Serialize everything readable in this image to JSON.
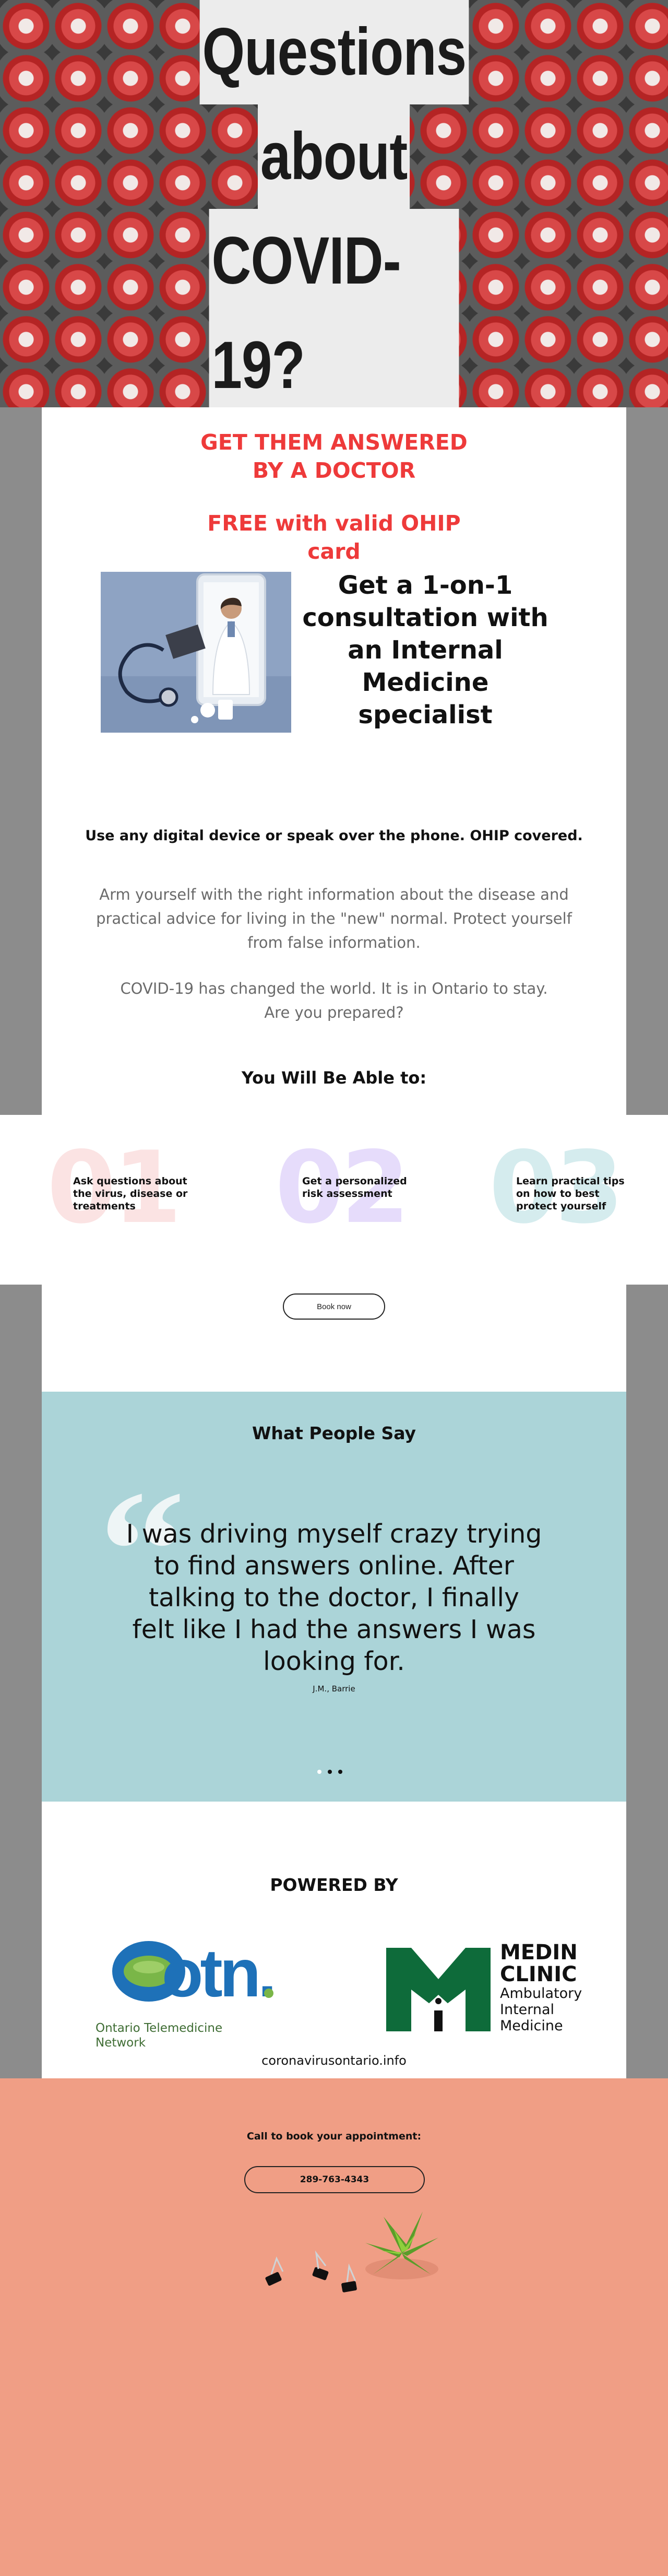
{
  "hero": {
    "title_lines": [
      "Questions",
      "about",
      "COVID-19?"
    ]
  },
  "intro": {
    "headline": "GET THEM ANSWERED BY A DOCTOR",
    "free_line": "FREE with valid OHIP card",
    "consult_title": "Get a 1-on-1 consultation with an Internal Medicine specialist",
    "digital_line": "Use any digital device or speak over the phone. OHIP covered.",
    "arm_paragraph": "Arm yourself with the right information about the disease and practical advice for living in the \"new\" normal. Protect yourself from false information.",
    "covid_line1": "COVID-19 has changed the world. It is in Ontario to stay.",
    "covid_line2": "Are you prepared?",
    "able_heading": "You Will Be Able to:"
  },
  "features": [
    {
      "number": "01",
      "text": "Ask questions about the virus, disease or treatments",
      "color": "#fbe3e3"
    },
    {
      "number": "02",
      "text": "Get a personalized risk assessment",
      "color": "#e6dcfb"
    },
    {
      "number": "03",
      "text": "Learn practical tips on how to best protect yourself",
      "color": "#d5ecee"
    }
  ],
  "book_now": {
    "label": "Book now"
  },
  "testimonial": {
    "heading": "What People Say",
    "quote": "I was driving myself crazy trying to find answers online. After talking to the doctor, I finally felt like I had the answers I was looking for.",
    "author": "J.M., Barrie",
    "slide_count": 3,
    "active_slide": 1
  },
  "partners": {
    "heading": "POWERED BY",
    "otn_logo_text": "otn.",
    "otn_name": "Ontario Telemedicine Network",
    "medin_title": "MEDIN CLINIC",
    "medin_sub": "Ambulatory Internal Medicine",
    "site": "coronavirusontario.info"
  },
  "footer": {
    "call_text": "Call to book your appointment:",
    "phone": "289-763-4343"
  },
  "colors": {
    "accent_red": "#ee3a3a",
    "testimonial_bg": "#abd4d8",
    "footer_bg": "#f09e85",
    "otn_blue": "#1e71b8",
    "otn_green": "#7ab648",
    "medin_green": "#0e6b3a"
  }
}
